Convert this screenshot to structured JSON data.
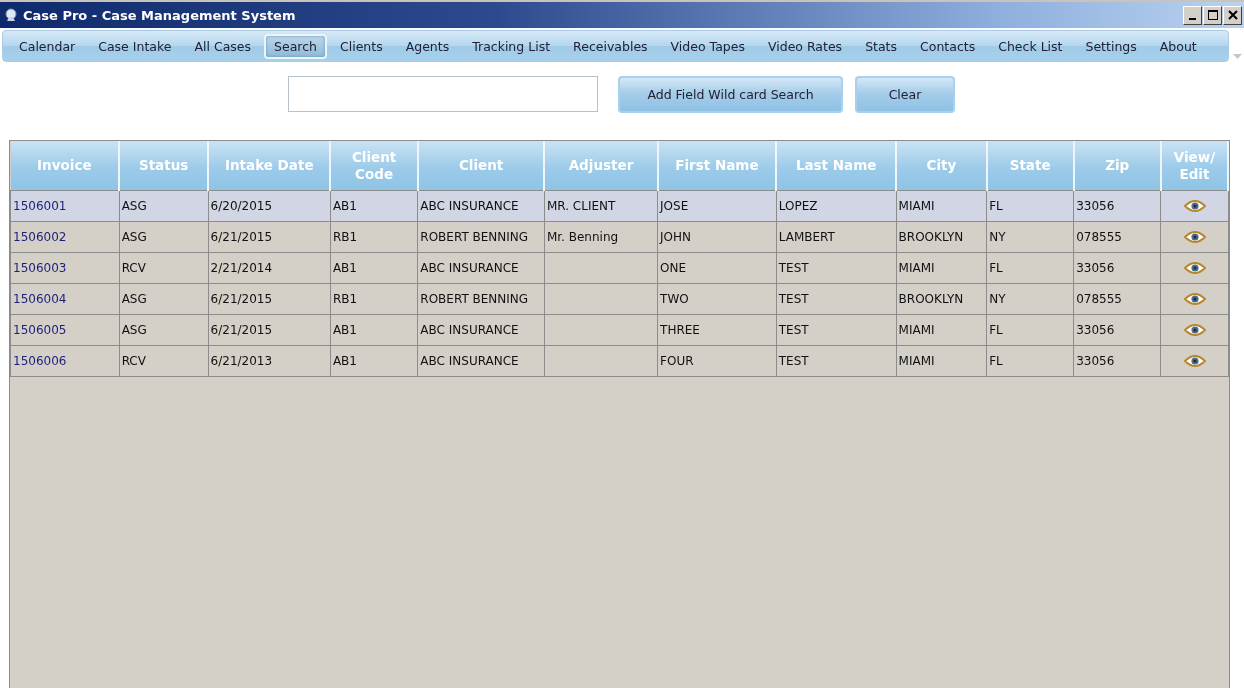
{
  "window": {
    "title": "Case Pro - Case Management System"
  },
  "tabs": [
    {
      "label": "Calendar",
      "selected": false
    },
    {
      "label": "Case Intake",
      "selected": false
    },
    {
      "label": "All Cases",
      "selected": false
    },
    {
      "label": "Search",
      "selected": true
    },
    {
      "label": "Clients",
      "selected": false
    },
    {
      "label": "Agents",
      "selected": false
    },
    {
      "label": "Tracking List",
      "selected": false
    },
    {
      "label": "Receivables",
      "selected": false
    },
    {
      "label": "Video Tapes",
      "selected": false
    },
    {
      "label": "Video Rates",
      "selected": false
    },
    {
      "label": "Stats",
      "selected": false
    },
    {
      "label": "Contacts",
      "selected": false
    },
    {
      "label": "Check List",
      "selected": false
    },
    {
      "label": "Settings",
      "selected": false
    },
    {
      "label": "About",
      "selected": false
    }
  ],
  "search": {
    "buttons": [
      "Add Field Wild card Search",
      "Clear"
    ]
  },
  "table": {
    "columns": [
      "Invoice",
      "Status",
      "Intake Date",
      "Client Code",
      "Client",
      "Adjuster",
      "First Name",
      "Last Name",
      "City",
      "State",
      "Zip",
      "View/ Edit"
    ],
    "rows": [
      {
        "selected": true,
        "cells": [
          "1506001",
          "ASG",
          "6/20/2015",
          "AB1",
          "ABC INSURANCE",
          "MR. CLIENT",
          "JOSE",
          "LOPEZ",
          "MIAMI",
          "FL",
          "33056"
        ]
      },
      {
        "selected": false,
        "cells": [
          "1506002",
          "ASG",
          "6/21/2015",
          "RB1",
          "ROBERT BENNING",
          "Mr. Benning",
          "JOHN",
          "LAMBERT",
          "BROOKLYN",
          "NY",
          "078555"
        ]
      },
      {
        "selected": false,
        "cells": [
          "1506003",
          "RCV",
          "2/21/2014",
          "AB1",
          "ABC INSURANCE",
          "",
          "ONE",
          "TEST",
          "MIAMI",
          "FL",
          "33056"
        ]
      },
      {
        "selected": false,
        "cells": [
          "1506004",
          "ASG",
          "6/21/2015",
          "RB1",
          "ROBERT BENNING",
          "",
          "TWO",
          "TEST",
          "BROOKLYN",
          "NY",
          "078555"
        ]
      },
      {
        "selected": false,
        "cells": [
          "1506005",
          "ASG",
          "6/21/2015",
          "AB1",
          "ABC INSURANCE",
          "",
          "THREE",
          "TEST",
          "MIAMI",
          "FL",
          "33056"
        ]
      },
      {
        "selected": false,
        "cells": [
          "1506006",
          "RCV",
          "6/21/2013",
          "AB1",
          "ABC INSURANCE",
          "",
          "FOUR",
          "TEST",
          "MIAMI",
          "FL",
          "33056"
        ]
      }
    ]
  }
}
